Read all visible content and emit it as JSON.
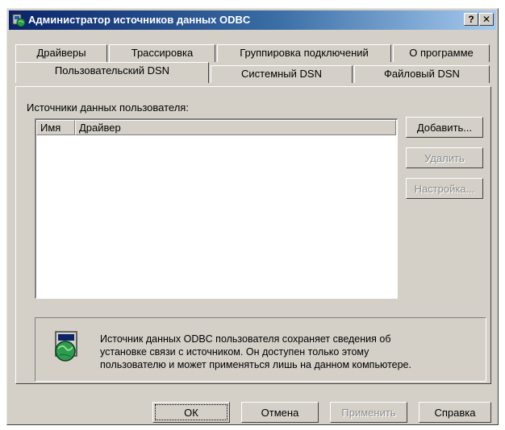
{
  "window": {
    "title": "Администратор источников данных ODBC",
    "help_button": "?",
    "close_button": "✕"
  },
  "tabs_back": [
    {
      "label": "Драйверы"
    },
    {
      "label": "Трассировка"
    },
    {
      "label": "Группировка подключений"
    },
    {
      "label": "О программе"
    }
  ],
  "tabs_front": [
    {
      "label": "Пользовательский DSN",
      "active": true
    },
    {
      "label": "Системный DSN",
      "active": false
    },
    {
      "label": "Файловый DSN",
      "active": false
    }
  ],
  "user_dsn": {
    "section_label": "Источники данных пользователя:",
    "columns": [
      {
        "label": "Имя"
      },
      {
        "label": "Драйвер"
      }
    ],
    "rows": [],
    "buttons": {
      "add": "Добавить...",
      "remove": "Удалить",
      "configure": "Настройка..."
    },
    "info_lines": [
      "Источник данных ODBC пользователя сохраняет сведения об",
      "установке связи с источником.  Он доступен только этому",
      "пользователю и может применяться лишь на данном компьютере."
    ]
  },
  "footer": {
    "ok": "ОК",
    "cancel": "Отмена",
    "apply": "Применить",
    "help": "Справка"
  },
  "icons": {
    "title": "odbc-datasource-icon",
    "info": "globe-datasource-icon"
  },
  "colors": {
    "face": "#d4d0c8",
    "titlebar_start": "#0a246a",
    "titlebar_end": "#a6caf0",
    "disabled_text": "#8c8c8c"
  }
}
